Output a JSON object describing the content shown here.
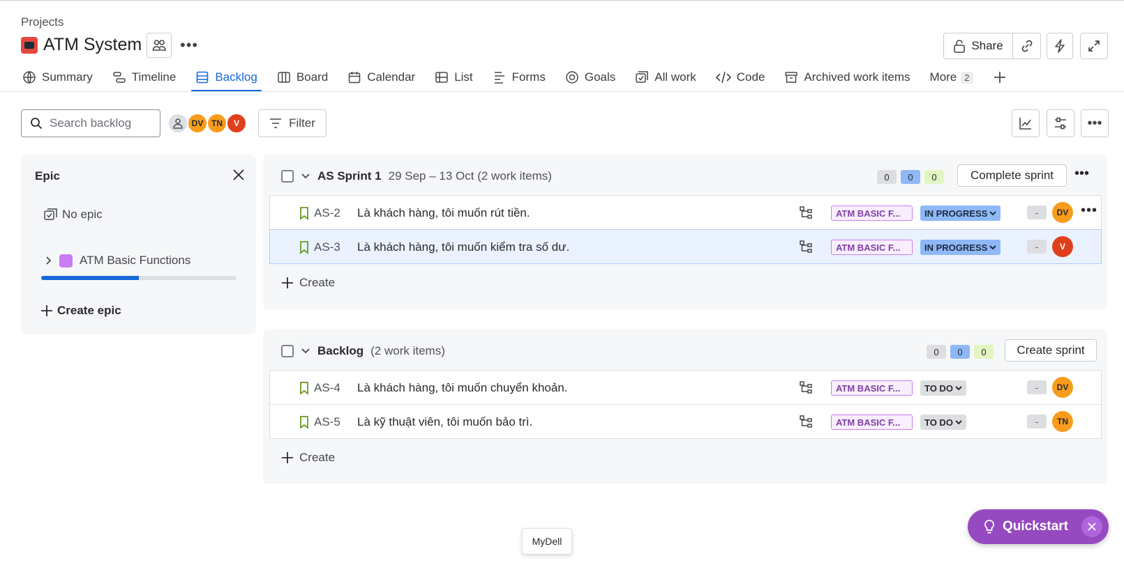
{
  "header": {
    "breadcrumb": "Projects",
    "project_title": "ATM System",
    "share_label": "Share"
  },
  "tabs": [
    {
      "label": "Summary",
      "icon": "globe-icon"
    },
    {
      "label": "Timeline",
      "icon": "timeline-icon"
    },
    {
      "label": "Backlog",
      "icon": "backlog-icon",
      "active": true
    },
    {
      "label": "Board",
      "icon": "board-icon"
    },
    {
      "label": "Calendar",
      "icon": "calendar-icon"
    },
    {
      "label": "List",
      "icon": "list-icon"
    },
    {
      "label": "Forms",
      "icon": "forms-icon"
    },
    {
      "label": "Goals",
      "icon": "goals-icon"
    },
    {
      "label": "All work",
      "icon": "all-work-icon"
    },
    {
      "label": "Code",
      "icon": "code-icon"
    },
    {
      "label": "Archived work items",
      "icon": "archive-icon"
    }
  ],
  "tabs_more": {
    "label": "More",
    "count": "2"
  },
  "toolbar": {
    "search_placeholder": "Search backlog",
    "avatars": [
      "DV",
      "TN",
      "V"
    ],
    "filter_label": "Filter"
  },
  "epic_panel": {
    "title": "Epic",
    "no_epic": "No epic",
    "epic_name": "ATM Basic Functions",
    "epic_progress": 0.5,
    "create_epic": "Create epic"
  },
  "sprint": {
    "name": "AS Sprint 1",
    "meta": "29 Sep – 13 Oct (2 work items)",
    "counts": [
      "0",
      "0",
      "0"
    ],
    "action": "Complete sprint",
    "create_label": "Create",
    "items": [
      {
        "key": "AS-2",
        "summary": "Là khách hàng, tôi muốn rút tiền.",
        "epic": "ATM BASIC F...",
        "status": "IN PROGRESS",
        "estimate": "-",
        "assignee": "DV"
      },
      {
        "key": "AS-3",
        "summary": "Là khách hàng, tôi muốn kiểm tra số dư.",
        "epic": "ATM BASIC F...",
        "status": "IN PROGRESS",
        "estimate": "-",
        "assignee": "V"
      }
    ]
  },
  "backlog": {
    "name": "Backlog",
    "meta": "(2 work items)",
    "counts": [
      "0",
      "0",
      "0"
    ],
    "action": "Create sprint",
    "create_label": "Create",
    "items": [
      {
        "key": "AS-4",
        "summary": "Là khách hàng, tôi muốn chuyển khoản.",
        "epic": "ATM BASIC F...",
        "status": "TO DO",
        "estimate": "-",
        "assignee": "DV"
      },
      {
        "key": "AS-5",
        "summary": "Là kỹ thuật viên, tôi muốn bảo trì.",
        "epic": "ATM BASIC F...",
        "status": "TO DO",
        "estimate": "-",
        "assignee": "TN"
      }
    ]
  },
  "tooltip": "MyDell",
  "quickstart": {
    "label": "Quickstart"
  },
  "colors": {
    "accent": "#1868db",
    "epic_purple": "#c97cf4",
    "quickstart": "#964ac0"
  }
}
